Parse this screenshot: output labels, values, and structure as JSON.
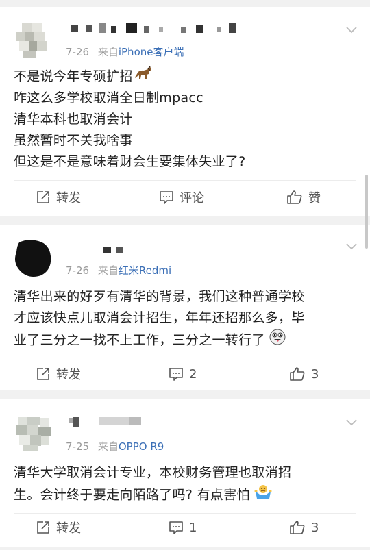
{
  "posts": [
    {
      "date": "7-26",
      "source_prefix": "来自",
      "source": "iPhone客户端",
      "lines": [
        "不是说今年专硕扩招",
        "咋这么多学校取消全日制mpacc",
        "清华本科也取消会计",
        "虽然暂时不关我啥事",
        "但这是不是意味着财会生要集体失业了?"
      ],
      "repost_label": "转发",
      "comment_label": "评论",
      "like_label": "赞",
      "icons": [
        "horse-emoji"
      ]
    },
    {
      "date": "7-26",
      "source_prefix": "来自",
      "source": "红米Redmi",
      "lines": [
        "清华出来的好歹有清华的背景，我们这种普通学校",
        "才应该快点儿取消会计招生，年年还招那么多，毕",
        "业了三分之一找不上工作，三分之一转行了"
      ],
      "repost_label": "转发",
      "comment_label": "2",
      "like_label": "3",
      "icons": [
        "crazy-face-emoji"
      ]
    },
    {
      "date": "7-25",
      "source_prefix": "来自",
      "source": "OPPO R9",
      "lines": [
        "清华大学取消会计专业，本校财务管理也取消招",
        "生。会计终于要走向陌路了吗? 有点害怕"
      ],
      "repost_label": "转发",
      "comment_label": "1",
      "like_label": "3",
      "icons": [
        "shrug-emoji"
      ]
    }
  ],
  "colors": {
    "source_link": "#3b6fb6",
    "meta_gray": "#999999",
    "background": "#f1f1f1"
  }
}
